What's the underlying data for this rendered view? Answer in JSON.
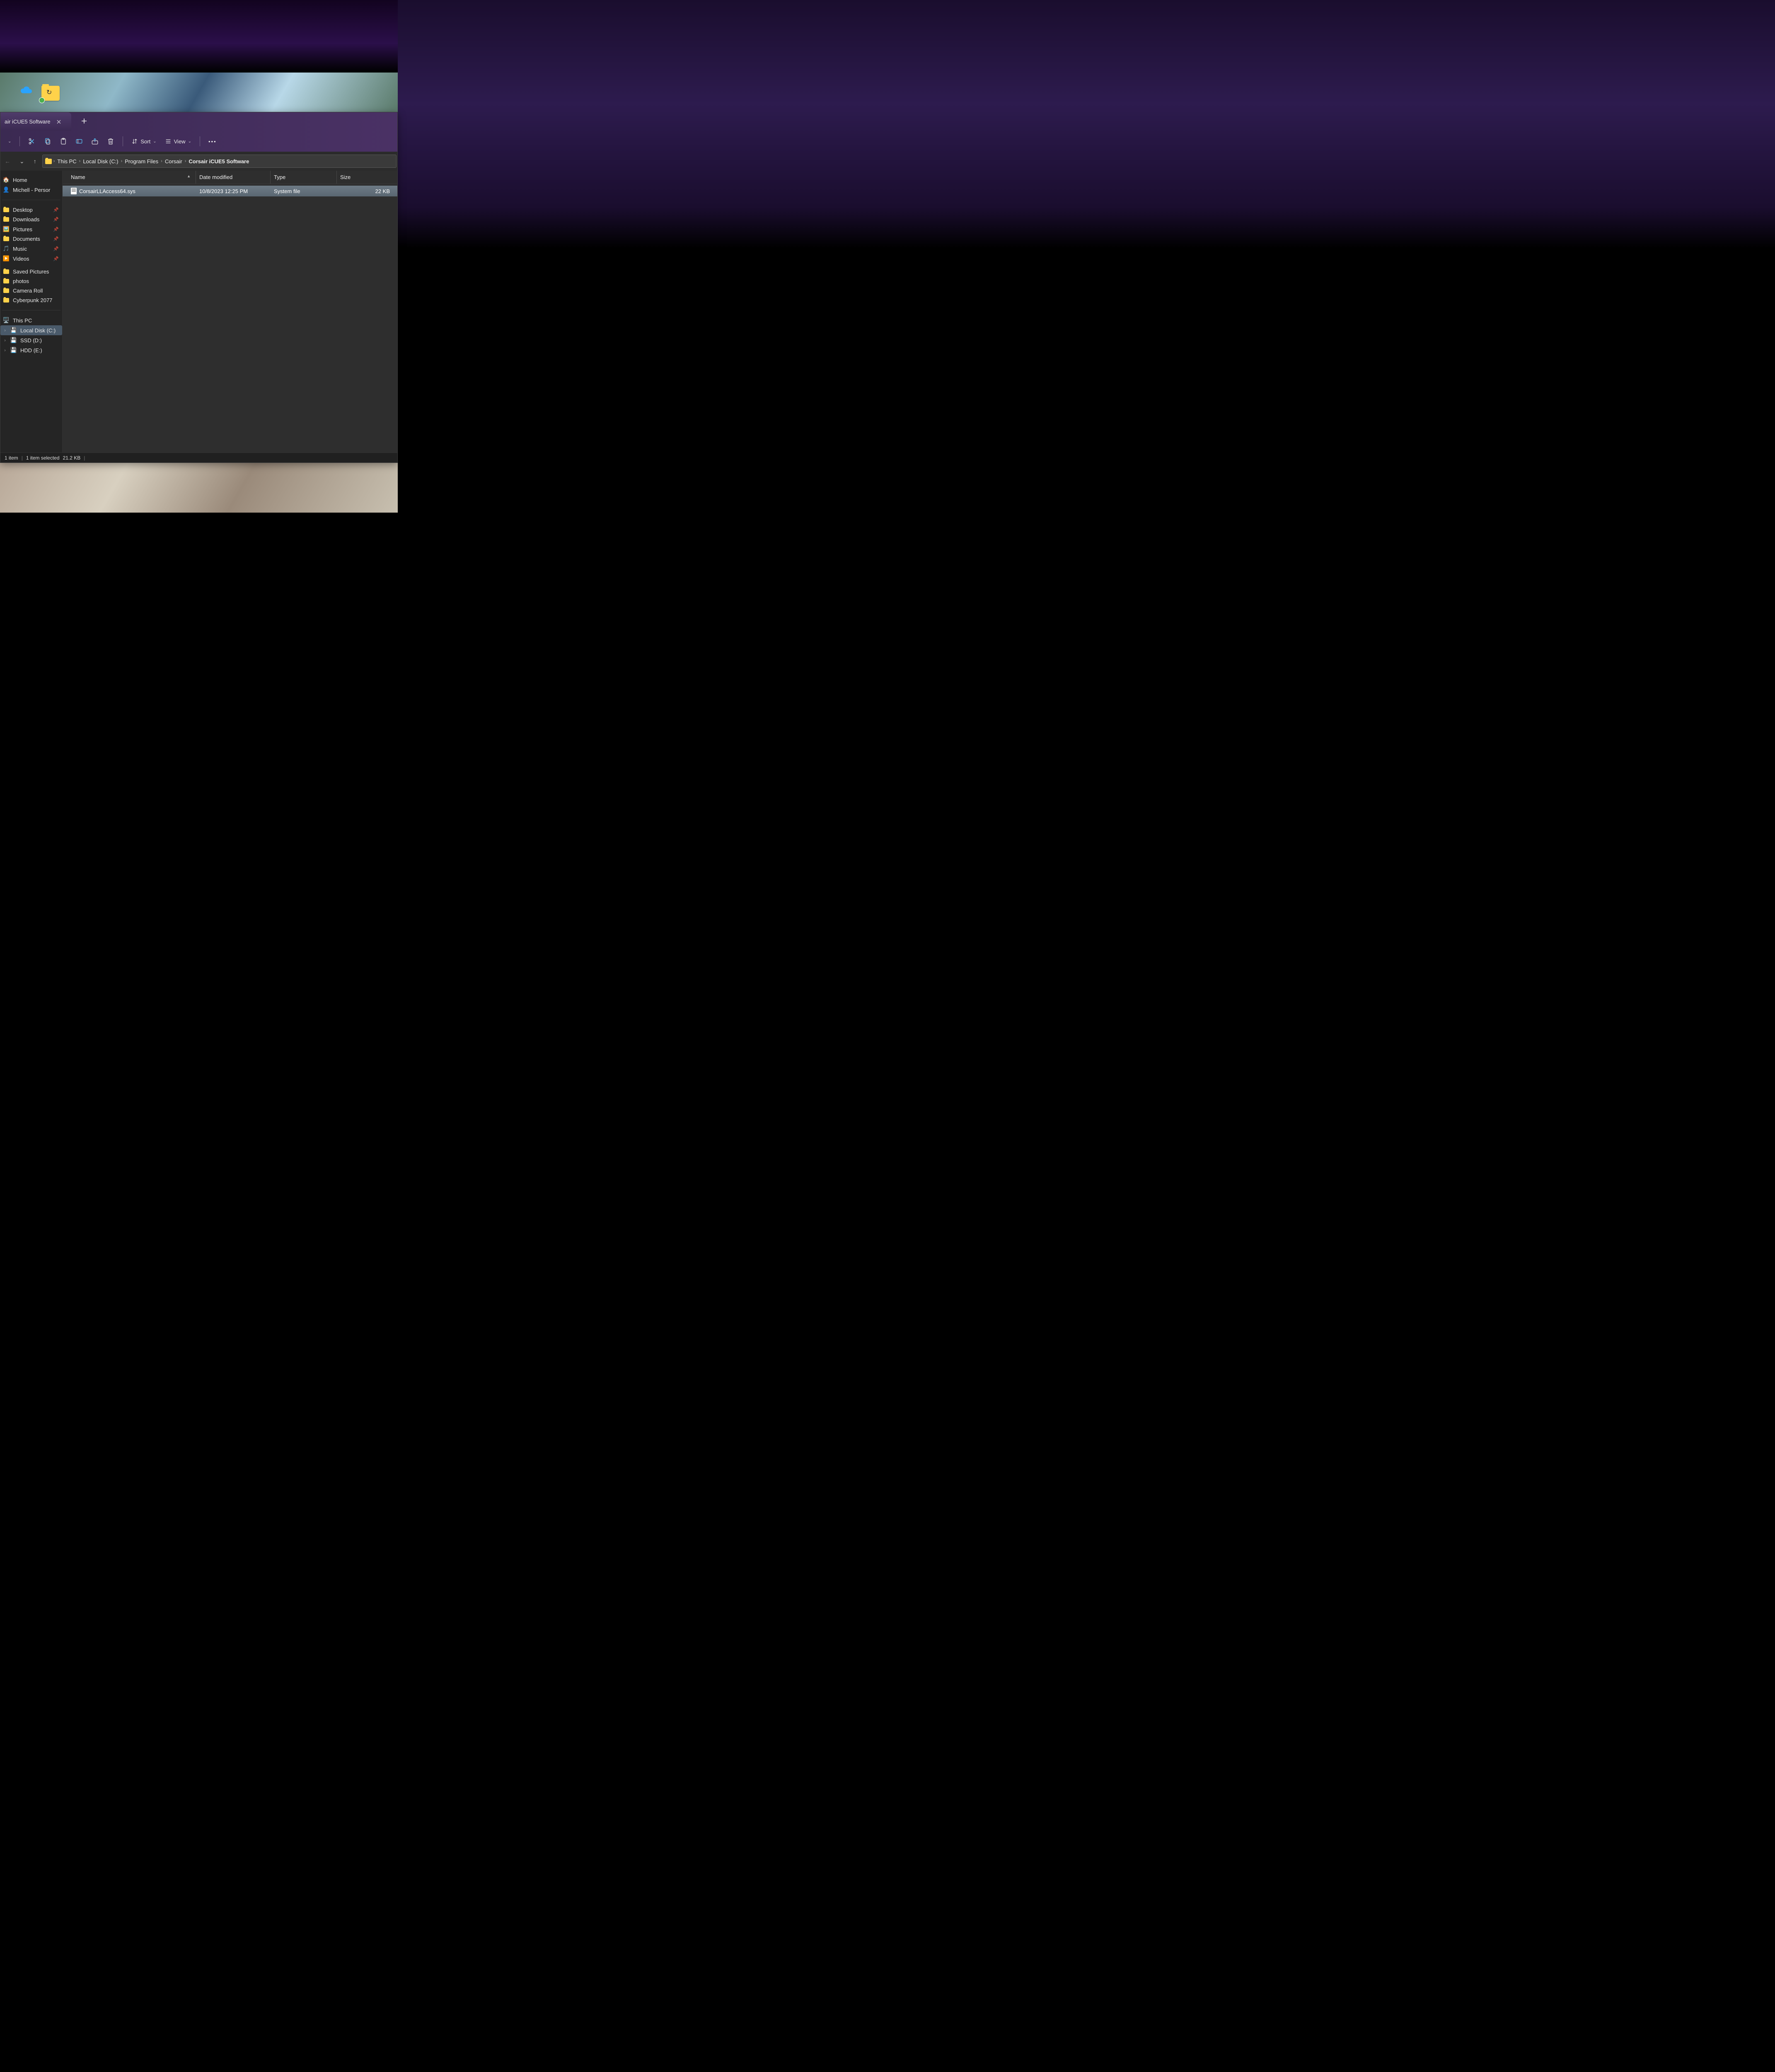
{
  "tab": {
    "title": "air iCUE5 Software"
  },
  "toolbar": {
    "new_dropdown": "v",
    "sort_label": "Sort",
    "view_label": "View"
  },
  "breadcrumb": {
    "items": [
      {
        "label": "This PC"
      },
      {
        "label": "Local Disk (C:)"
      },
      {
        "label": "Program Files"
      },
      {
        "label": "Corsair"
      },
      {
        "label": "Corsair iCUE5 Software"
      }
    ]
  },
  "sidebar": {
    "home": "Home",
    "user": "Michell - Persor",
    "pinned": [
      {
        "label": "Desktop",
        "pin": true
      },
      {
        "label": "Downloads",
        "pin": true
      },
      {
        "label": "Pictures",
        "pin": true
      },
      {
        "label": "Documents",
        "pin": true
      },
      {
        "label": "Music",
        "pin": true
      },
      {
        "label": "Videos",
        "pin": true
      }
    ],
    "folders": [
      {
        "label": "Saved Pictures"
      },
      {
        "label": "photos"
      },
      {
        "label": "Camera Roll"
      },
      {
        "label": "Cyberpunk 2077"
      }
    ],
    "thispc": "This PC",
    "drives": [
      {
        "label": "Local Disk (C:)",
        "selected": true
      },
      {
        "label": "SSD (D:)"
      },
      {
        "label": "HDD (E:)"
      }
    ]
  },
  "columns": {
    "name": "Name",
    "date": "Date modified",
    "type": "Type",
    "size": "Size"
  },
  "files": [
    {
      "name": "CorsairLLAccess64.sys",
      "date": "10/8/2023 12:25 PM",
      "type": "System file",
      "size": "22 KB",
      "selected": true
    }
  ],
  "status": {
    "count": "1 item",
    "selection": "1 item selected",
    "sel_size": "21.2 KB"
  }
}
